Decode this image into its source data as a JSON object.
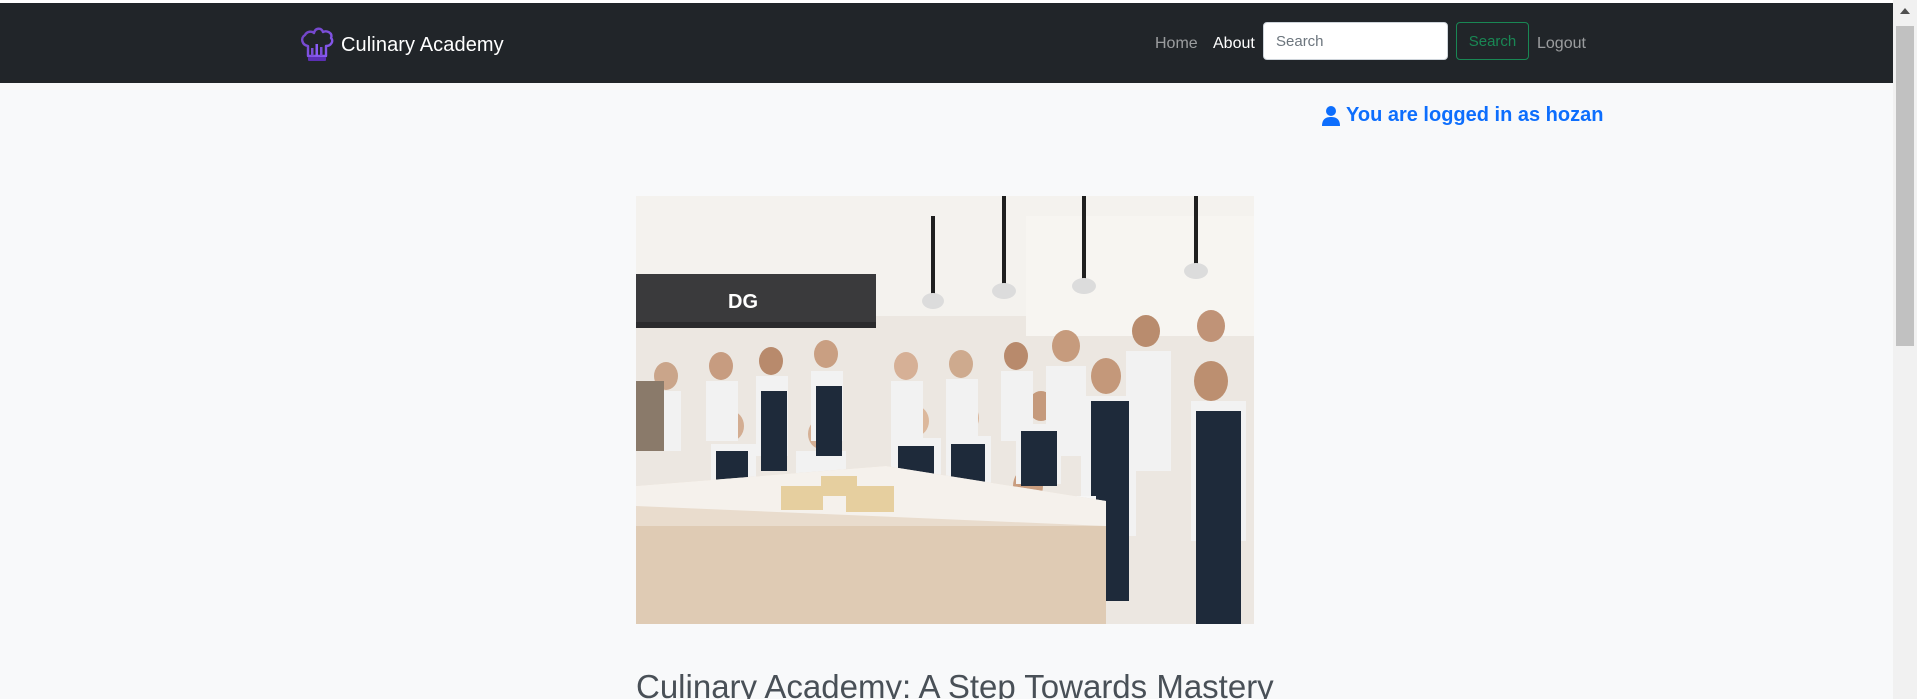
{
  "navbar": {
    "brand": "Culinary Academy",
    "links": {
      "home": "Home",
      "about": "About",
      "logout": "Logout"
    },
    "search": {
      "placeholder": "Search",
      "value": "",
      "button_label": "Search"
    },
    "background_color": "#212529"
  },
  "user": {
    "logged_in_text": "You are logged in as hozan",
    "accent_color": "#0d6efd"
  },
  "hero": {
    "alt": "Culinary Academy chefs team in kitchen"
  },
  "article": {
    "title": "Culinary Academy: A Step Towards Mastery"
  },
  "icons": {
    "brand": "chef-hat-icon",
    "user": "user-icon",
    "scroll_up": "chevron-up-icon"
  }
}
